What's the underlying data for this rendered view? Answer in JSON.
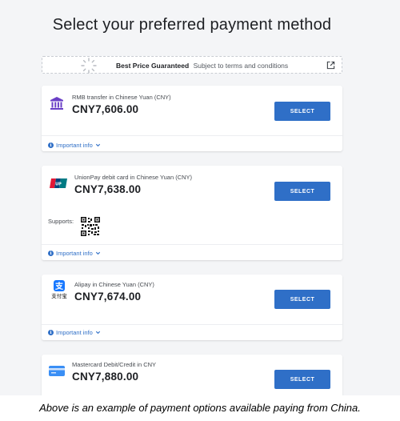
{
  "page": {
    "title": "Select your preferred payment method"
  },
  "guarantee": {
    "strong": "Best Price Guaranteed",
    "sub": "Subject to terms and conditions"
  },
  "options": [
    {
      "label": "RMB transfer in Chinese Yuan (CNY)",
      "price": "CNY7,606.00",
      "button": "SELECT",
      "info": "Important info",
      "icon": "bank-icon"
    },
    {
      "label": "UnionPay debit card in Chinese Yuan (CNY)",
      "price": "CNY7,638.00",
      "button": "SELECT",
      "info": "Important info",
      "supports": "Supports:",
      "icon": "unionpay-icon"
    },
    {
      "label": "Alipay in Chinese Yuan (CNY)",
      "price": "CNY7,674.00",
      "button": "SELECT",
      "info": "Important info",
      "icon": "alipay-icon",
      "icon_text": "支付宝"
    },
    {
      "label": "Mastercard Debit/Credit in CNY",
      "price": "CNY7,880.00",
      "button": "SELECT",
      "icon": "card-icon"
    }
  ],
  "caption": "Above is an example of payment options available paying from China.",
  "colors": {
    "accent": "#2f6fc7",
    "background": "#f4f5f7",
    "bank_icon": "#6a3fc6",
    "alipay": "#1677ff",
    "card_icon": "#3a8ff5"
  }
}
